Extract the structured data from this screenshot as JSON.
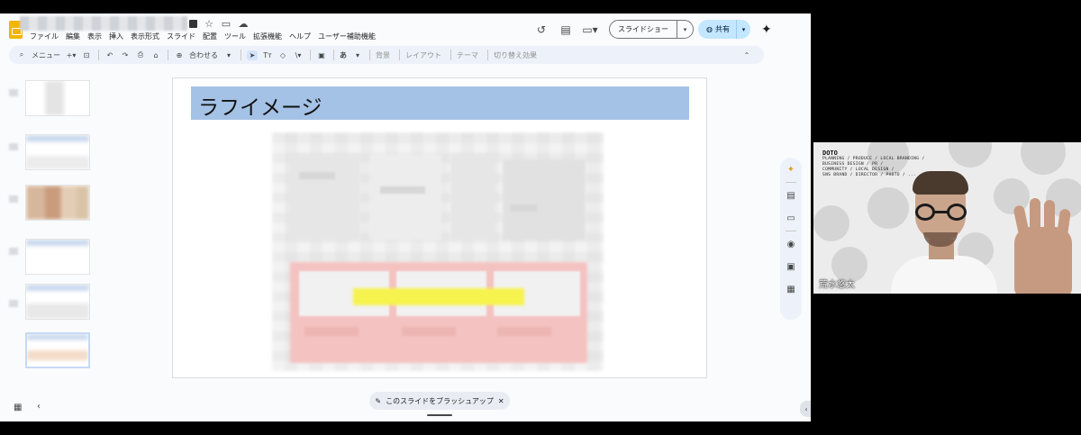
{
  "header": {
    "title_icons": [
      "star-icon",
      "move-to-folder-icon",
      "cloud-status-icon"
    ],
    "menu": [
      "ファイル",
      "編集",
      "表示",
      "挿入",
      "表示形式",
      "スライド",
      "配置",
      "ツール",
      "拡張機能",
      "ヘルプ",
      "ユーザー補助機能"
    ],
    "slideshow_label": "スライドショー",
    "share_label": "共有"
  },
  "toolbar": {
    "menu_search_label": "メニュー",
    "zoom_label": "合わせる",
    "text_style_label": "あ",
    "background_label": "背景",
    "layout_label": "レイアウト",
    "theme_label": "テーマ",
    "transition_label": "切り替え効果"
  },
  "slide": {
    "title": "ラフイメージ"
  },
  "bottom": {
    "brushup_label": "このスライドをブラッシュアップ"
  },
  "video": {
    "participant_name": "荒水悠太",
    "brand_logo": "DOTO",
    "brand_lines": [
      "PLANNING / PRODUCE / LOCAL BRANDING /",
      "BUSINESS DESIGN / PR / ",
      "COMMUNITY / LOCAL DESIGN /",
      "SNS BRAND / DIRECTOR / PHOTO / ..."
    ]
  },
  "colors": {
    "title_bar": "#a4c2e6",
    "share_button": "#c2e7ff",
    "toolbar_bg": "#edf2fa",
    "logo_yellow": "#f4b400"
  }
}
